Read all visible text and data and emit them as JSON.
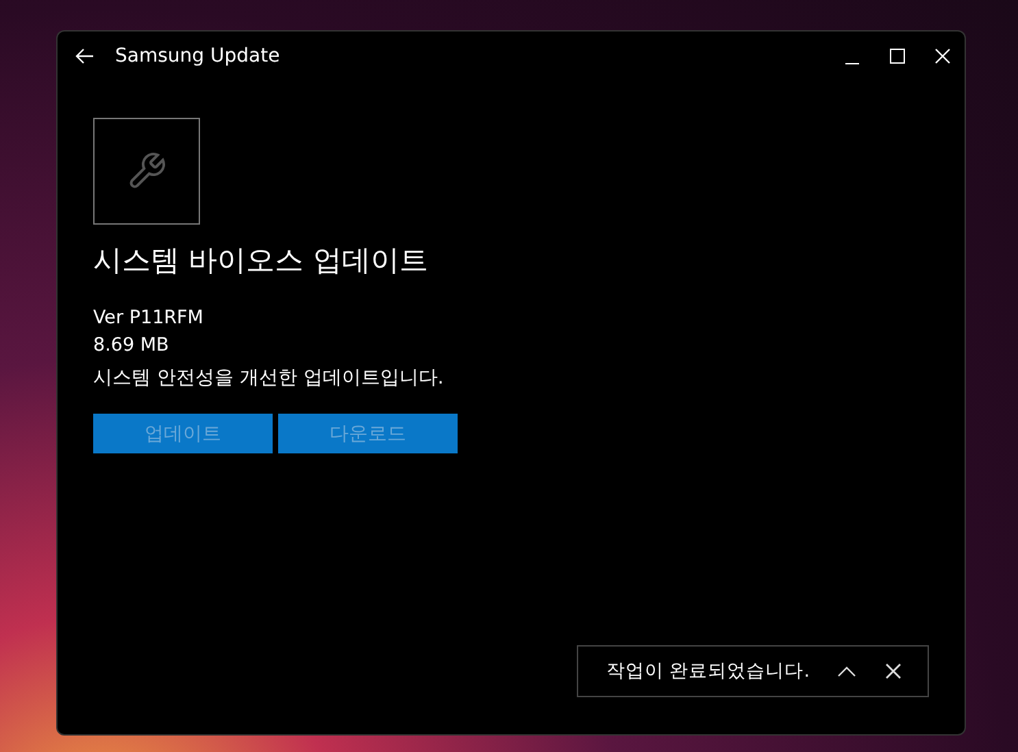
{
  "window": {
    "title": "Samsung Update"
  },
  "update": {
    "title": "시스템 바이오스 업데이트",
    "version": "Ver P11RFM",
    "size": "8.69 MB",
    "description": "시스템 안전성을 개선한 업데이트입니다."
  },
  "buttons": [
    {
      "label": "업데이트",
      "disabled": true
    },
    {
      "label": "다운로드",
      "disabled": true
    }
  ],
  "notification": {
    "message": "작업이 완료되었습니다."
  }
}
